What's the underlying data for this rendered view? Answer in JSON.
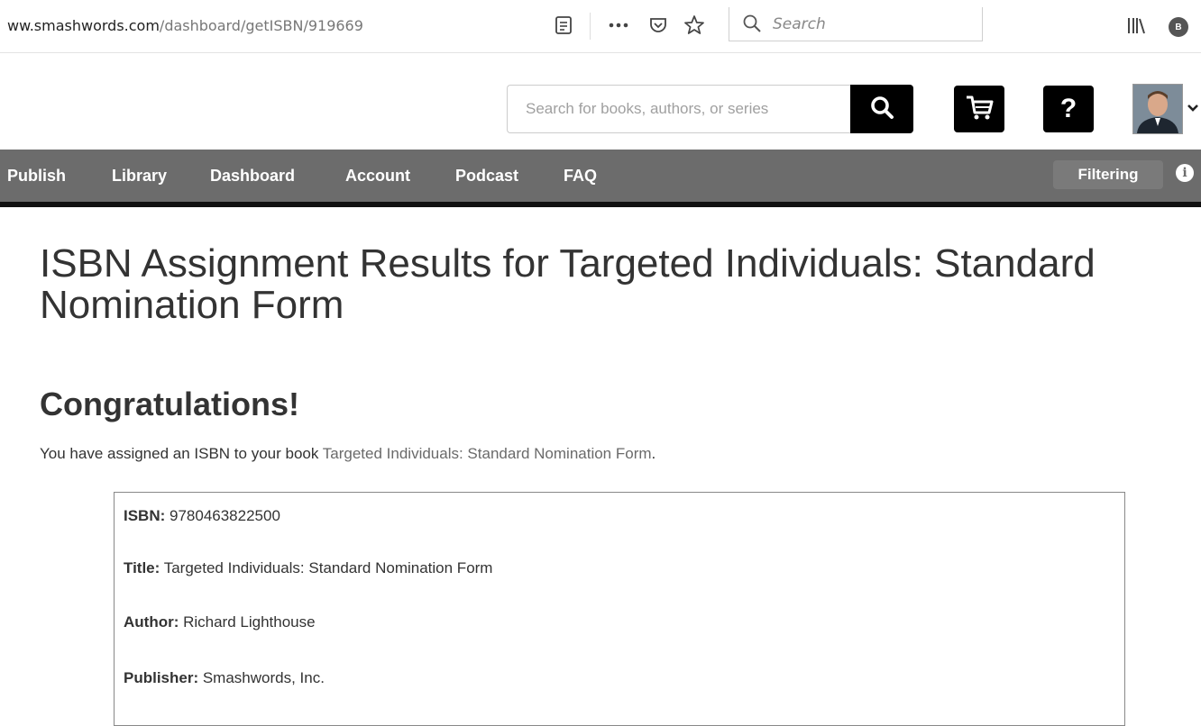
{
  "browser": {
    "url_host": "ww.smashwords.com",
    "url_path": "/dashboard/getISBN/919669",
    "search_placeholder": "Search",
    "profile_badge": "B"
  },
  "header": {
    "search_placeholder": "Search for books, authors, or series",
    "help_label": "?"
  },
  "nav": {
    "items": [
      "Publish",
      "Library",
      "Dashboard",
      "Account",
      "Podcast",
      "FAQ"
    ],
    "filtering_label": "Filtering",
    "info_label": "i"
  },
  "content": {
    "title": "ISBN Assignment Results for Targeted Individuals: Standard Nomination Form",
    "congrats": "Congratulations!",
    "assigned_prefix": "You have assigned an ISBN to your book ",
    "book_title_link": "Targeted Individuals: Standard Nomination Form",
    "assigned_suffix": ".",
    "fields": [
      {
        "label": "ISBN:",
        "value": " 9780463822500"
      },
      {
        "label": "Title:",
        "value": " Targeted Individuals: Standard Nomination Form"
      },
      {
        "label": "Author:",
        "value": " Richard Lighthouse"
      },
      {
        "label": "Publisher:",
        "value": " Smashwords, Inc."
      }
    ]
  },
  "colors": {
    "nav_bg": "#6c6c6c",
    "nav_border": "#111111",
    "button_black": "#000000"
  }
}
